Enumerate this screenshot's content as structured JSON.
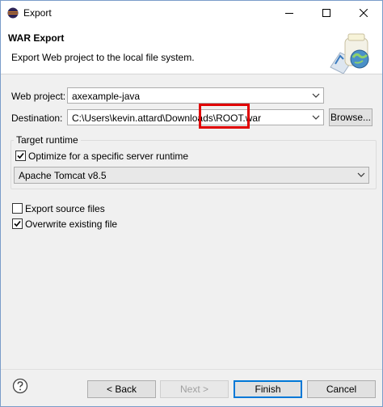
{
  "window": {
    "title": "Export"
  },
  "header": {
    "title": "WAR Export",
    "description": "Export Web project to the local file system."
  },
  "form": {
    "web_project_label": "Web project:",
    "web_project_value": "axexample-java",
    "destination_label": "Destination:",
    "destination_value": "C:\\Users\\kevin.attard\\Downloads\\ROOT.war",
    "browse_label": "Browse...",
    "target_runtime_title": "Target runtime",
    "optimize_label": "Optimize for a specific server runtime",
    "optimize_checked": true,
    "runtime_value": "Apache Tomcat v8.5",
    "export_source_label": "Export source files",
    "export_source_checked": false,
    "overwrite_label": "Overwrite existing file",
    "overwrite_checked": true
  },
  "buttons": {
    "back": "< Back",
    "next": "Next >",
    "finish": "Finish",
    "cancel": "Cancel"
  },
  "colors": {
    "highlight": "#e00000",
    "default_button_border": "#0078d7"
  },
  "icons": [
    "eclipse-app-icon",
    "minimize-icon",
    "maximize-icon",
    "close-icon",
    "war-banner-icon",
    "dropdown-arrow-icon",
    "checkmark-icon",
    "help-icon"
  ]
}
